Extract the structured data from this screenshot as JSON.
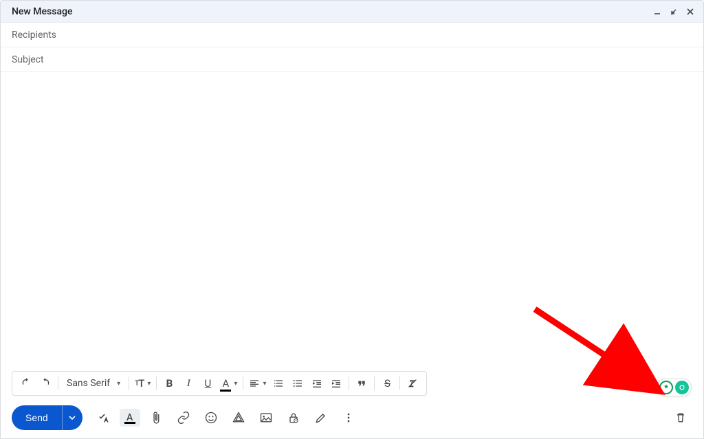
{
  "header": {
    "title": "New Message"
  },
  "fields": {
    "recipients_label": "Recipients",
    "subject_label": "Subject"
  },
  "format_toolbar": {
    "font_family": "Sans Serif"
  },
  "send": {
    "label": "Send"
  },
  "colors": {
    "primary": "#0b57d0",
    "arrow": "#ff0000",
    "grammarly": "#15c39a"
  },
  "extensions": {
    "badge1": "✿",
    "badge2": "G"
  },
  "annotation": {
    "arrow_description": "red arrow pointing to extension badges"
  }
}
